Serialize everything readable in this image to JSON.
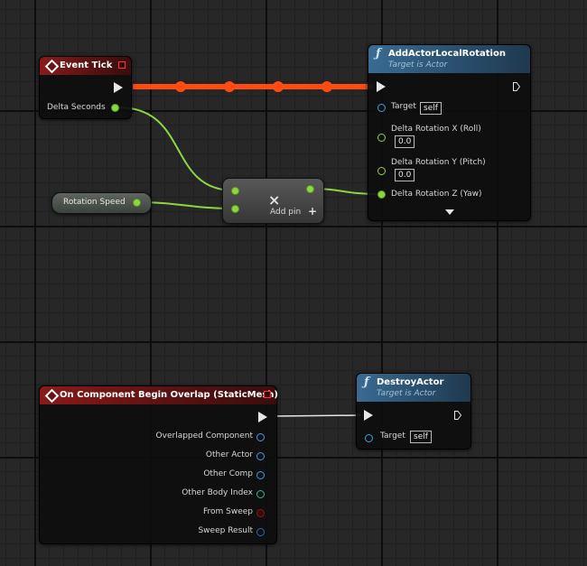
{
  "graph": {
    "event_tick": {
      "title": "Event Tick",
      "pins": {
        "delta_seconds": "Delta Seconds"
      }
    },
    "add_actor_local_rotation": {
      "title": "AddActorLocalRotation",
      "subtitle": "Target is Actor",
      "pins": {
        "target": "Target",
        "target_value": "self",
        "roll": "Delta Rotation X (Roll)",
        "roll_value": "0.0",
        "pitch": "Delta Rotation Y (Pitch)",
        "pitch_value": "0.0",
        "yaw": "Delta Rotation Z (Yaw)"
      }
    },
    "rotation_speed": {
      "label": "Rotation Speed"
    },
    "multiply": {
      "symbol": "×",
      "add_pin": "Add pin",
      "add_icon": "+"
    },
    "begin_overlap": {
      "title": "On Component Begin Overlap (StaticMesh)",
      "pins": [
        "Overlapped Component",
        "Other Actor",
        "Other Comp",
        "Other Body Index",
        "From Sweep",
        "Sweep Result"
      ]
    },
    "destroy_actor": {
      "title": "DestroyActor",
      "subtitle": "Target is Actor",
      "pins": {
        "target": "Target",
        "target_value": "self"
      }
    }
  },
  "colors": {
    "event_header": "#8c1a1a",
    "function_header": "#3a6b92",
    "exec_wire_active": "#ff4a10",
    "exec_wire": "#e6e6e6",
    "float_pin": "#8ed640",
    "object_pin": "#3aa3e0",
    "bool_pin": "#8a1a1a",
    "int_pin": "#20c090",
    "struct_pin": "#2a6bb0"
  },
  "icons": {
    "event": "event-diamond-icon",
    "function": "function-f-icon",
    "exec": "exec-arrow-icon",
    "delegate": "delegate-square-icon",
    "expand": "chevron-down-icon"
  }
}
